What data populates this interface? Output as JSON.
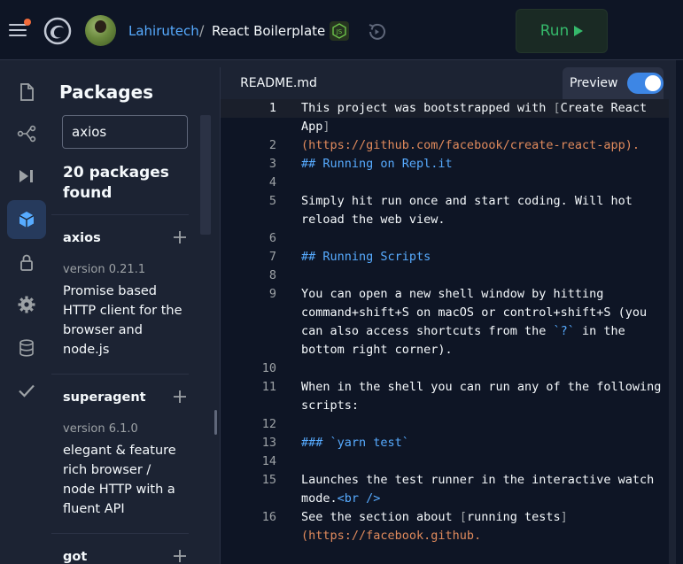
{
  "header": {
    "username": "Lahirutech",
    "separator": "/",
    "repl_name": "React Boilerplate",
    "language_icon": "nodejs-icon",
    "run_label": "Run",
    "colors": {
      "accent": "#57abff",
      "run_green": "#35b86a",
      "notification": "#f26b3a"
    }
  },
  "activity_bar": {
    "items": [
      {
        "name": "files-icon",
        "active": false
      },
      {
        "name": "version-control-icon",
        "active": false
      },
      {
        "name": "debugger-icon",
        "active": false
      },
      {
        "name": "packages-icon",
        "active": true
      },
      {
        "name": "secrets-lock-icon",
        "active": false
      },
      {
        "name": "settings-gear-icon",
        "active": false
      },
      {
        "name": "database-icon",
        "active": false
      },
      {
        "name": "checkmark-icon",
        "active": false
      }
    ]
  },
  "packages": {
    "title": "Packages",
    "search_value": "axios",
    "found_text": "20 packages found",
    "items": [
      {
        "name": "axios",
        "version": "version 0.21.1",
        "description": "Promise based HTTP client for the browser and node.js"
      },
      {
        "name": "superagent",
        "version": "version 6.1.0",
        "description": "elegant & feature rich browser / node HTTP with a fluent API"
      },
      {
        "name": "got",
        "version": "",
        "description": ""
      }
    ]
  },
  "editor": {
    "tab_label": "README.md",
    "preview_label": "Preview",
    "preview_on": true,
    "lines": [
      {
        "n": "1",
        "segments": [
          {
            "t": "This project was bootstrapped with "
          },
          {
            "t": "[",
            "c": "brk"
          },
          {
            "t": "Create React App"
          },
          {
            "t": "]",
            "c": "brk"
          },
          {
            "t": "\n(https://github.com/facebook/create-react-app).",
            "c": "lnk"
          }
        ]
      },
      {
        "n": "2",
        "segments": []
      },
      {
        "n": "3",
        "segments": [
          {
            "t": "## Running on Repl.it",
            "c": "hdr"
          }
        ]
      },
      {
        "n": "4",
        "segments": []
      },
      {
        "n": "5",
        "segments": [
          {
            "t": "Simply hit run once and start coding. Will hot reload the web view."
          }
        ]
      },
      {
        "n": "6",
        "segments": []
      },
      {
        "n": "7",
        "segments": [
          {
            "t": "## Running Scripts",
            "c": "hdr"
          }
        ]
      },
      {
        "n": "8",
        "segments": []
      },
      {
        "n": "9",
        "segments": [
          {
            "t": "You can open a new shell window by hitting command+shift+S on macOS or control+shift+S (you can also access shortcuts from the "
          },
          {
            "t": "`?`",
            "c": "hdr"
          },
          {
            "t": " in the bottom right corner)."
          }
        ]
      },
      {
        "n": "10",
        "segments": []
      },
      {
        "n": "11",
        "segments": [
          {
            "t": "When in the shell you can run any of the following scripts:"
          }
        ]
      },
      {
        "n": "12",
        "segments": []
      },
      {
        "n": "13",
        "segments": [
          {
            "t": "### `yarn test`",
            "c": "hdr"
          }
        ]
      },
      {
        "n": "14",
        "segments": []
      },
      {
        "n": "15",
        "segments": [
          {
            "t": "Launches the test runner in the interactive watch mode."
          },
          {
            "t": "<br />",
            "c": "tag"
          }
        ]
      },
      {
        "n": "16",
        "segments": [
          {
            "t": "See the section about "
          },
          {
            "t": "[",
            "c": "brk"
          },
          {
            "t": "running tests"
          },
          {
            "t": "]",
            "c": "brk"
          },
          {
            "t": "\n(https://facebook.github.",
            "c": "lnk"
          }
        ]
      }
    ]
  }
}
